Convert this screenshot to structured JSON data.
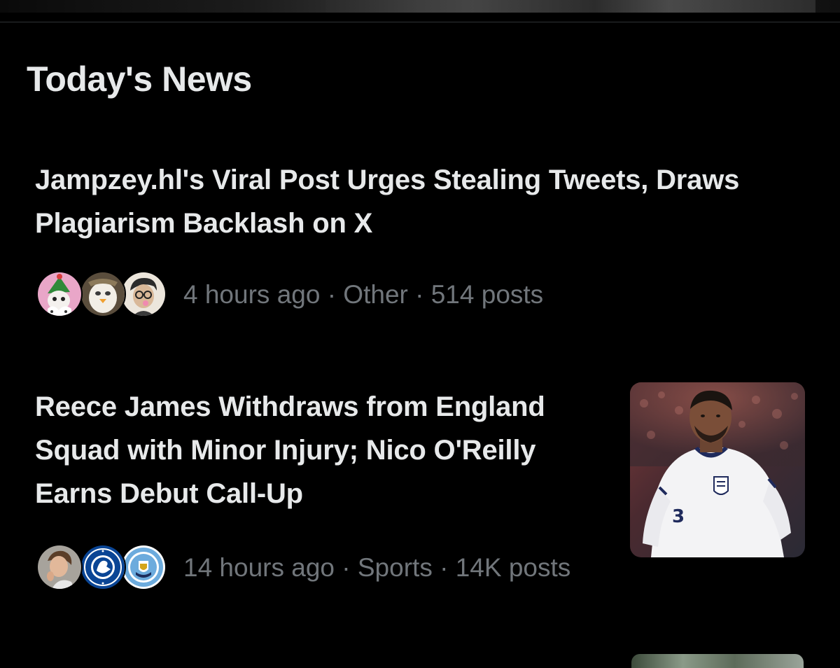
{
  "section": {
    "title": "Today's News"
  },
  "news": [
    {
      "headline": "Jampzey.hl's Viral Post Urges Stealing Tweets, Draws Plagiarism Backlash on X",
      "meta": "4 hours ago · Other · 514 posts",
      "avatars": [
        "elf-cartoon-avatar",
        "penguin-cartoon-avatar",
        "glasses-cartoon-avatar"
      ],
      "has_thumbnail": false
    },
    {
      "headline": "Reece James Withdraws from England Squad with Minor Injury; Nico O'Reilly Earns Debut Call-Up",
      "meta": "14 hours ago · Sports · 14K posts",
      "avatars": [
        "user-photo-avatar",
        "chelsea-crest-avatar",
        "manchester-city-crest-avatar"
      ],
      "has_thumbnail": true,
      "thumbnail": "england-footballer-photo"
    }
  ],
  "colors": {
    "background": "#000000",
    "text_primary": "#e7e9ea",
    "text_secondary": "#71767b",
    "divider": "#2f3336"
  }
}
